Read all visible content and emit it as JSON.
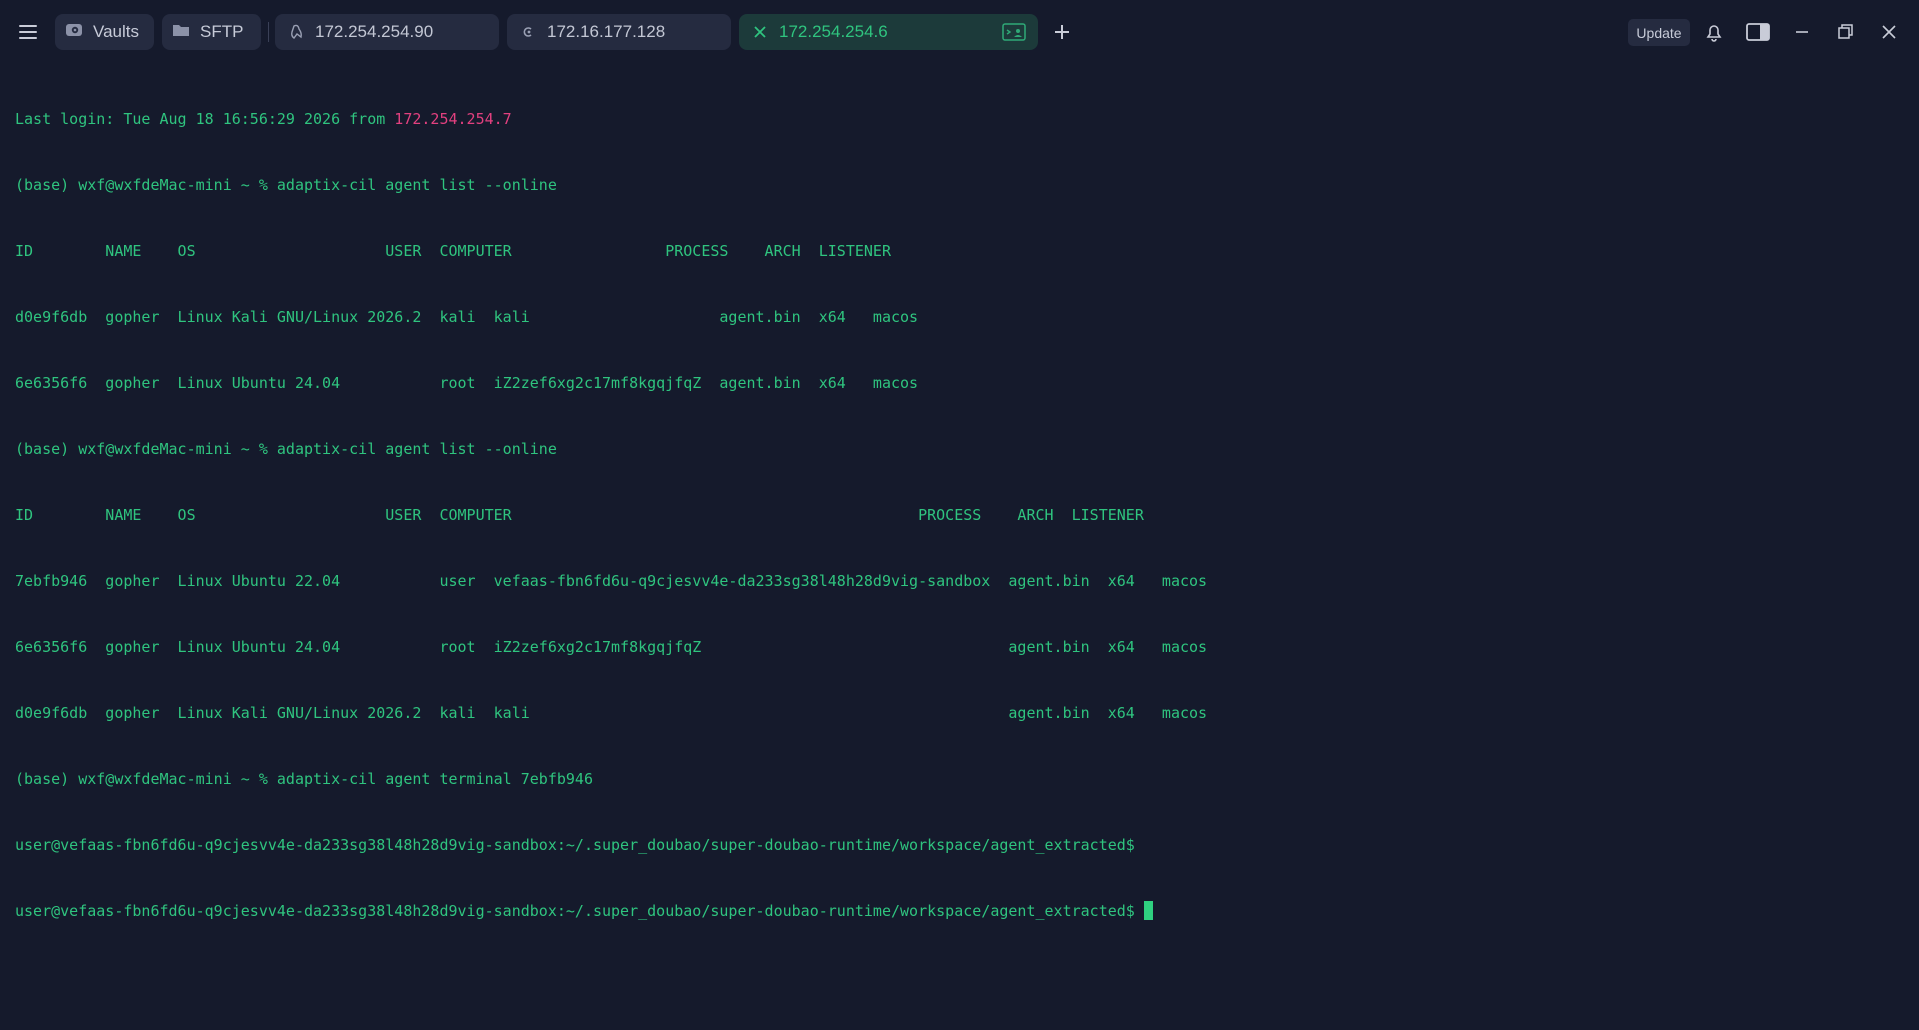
{
  "topbar": {
    "vaults_label": "Vaults",
    "sftp_label": "SFTP",
    "update_label": "Update",
    "tabs": [
      {
        "label": "172.254.254.90",
        "icon": "linux-logo-icon"
      },
      {
        "label": "172.16.177.128",
        "icon": "debian-logo-icon"
      },
      {
        "label": "172.254.254.6",
        "icon": "close-icon",
        "active": true
      }
    ],
    "accent_color": "#2fc47f"
  },
  "terminal": {
    "lines": [
      {
        "text": "Last login: Tue Aug 18 16:56:29 2026 from ",
        "highlight": "172.254.254.7"
      },
      {
        "text": "(base) wxf@wxfdeMac-mini ~ % adaptix-cil agent list --online"
      },
      {
        "text": "ID        NAME    OS                     USER  COMPUTER                 PROCESS    ARCH  LISTENER"
      },
      {
        "text": "d0e9f6db  gopher  Linux Kali GNU/Linux 2026.2  kali  kali                     agent.bin  x64   macos"
      },
      {
        "text": "6e6356f6  gopher  Linux Ubuntu 24.04           root  iZ2zef6xg2c17mf8kgqjfqZ  agent.bin  x64   macos"
      },
      {
        "text": "(base) wxf@wxfdeMac-mini ~ % adaptix-cil agent list --online"
      },
      {
        "text": "ID        NAME    OS                     USER  COMPUTER                                             PROCESS    ARCH  LISTENER"
      },
      {
        "text": "7ebfb946  gopher  Linux Ubuntu 22.04           user  vefaas-fbn6fd6u-q9cjesvv4e-da233sg38l48h28d9vig-sandbox  agent.bin  x64   macos"
      },
      {
        "text": "6e6356f6  gopher  Linux Ubuntu 24.04           root  iZ2zef6xg2c17mf8kgqjfqZ                                  agent.bin  x64   macos"
      },
      {
        "text": "d0e9f6db  gopher  Linux Kali GNU/Linux 2026.2  kali  kali                                                     agent.bin  x64   macos"
      },
      {
        "text": "(base) wxf@wxfdeMac-mini ~ % adaptix-cil agent terminal 7ebfb946"
      },
      {
        "text": "user@vefaas-fbn6fd6u-q9cjesvv4e-da233sg38l48h28d9vig-sandbox:~/.super_doubao/super-doubao-runtime/workspace/agent_extracted$"
      },
      {
        "text": "user@vefaas-fbn6fd6u-q9cjesvv4e-da233sg38l48h28d9vig-sandbox:~/.super_doubao/super-doubao-runtime/workspace/agent_extracted$ ",
        "cursor": true
      }
    ]
  }
}
